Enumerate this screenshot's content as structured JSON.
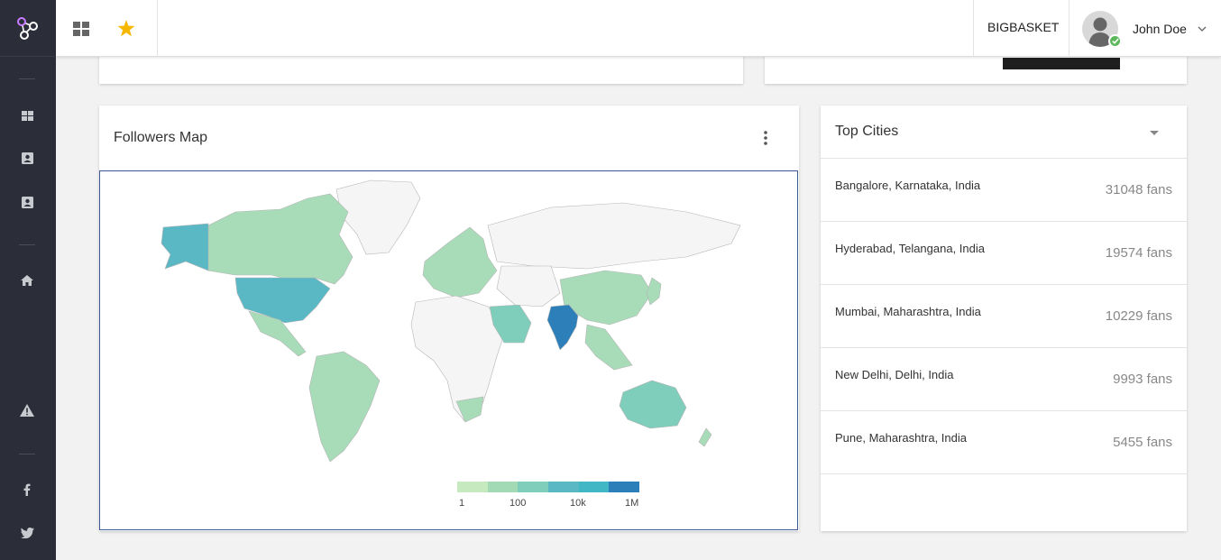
{
  "topbar": {
    "company": "BIGBASKET",
    "user_name": "John Doe"
  },
  "followers_map": {
    "title": "Followers Map",
    "legend_labels": [
      "1",
      "100",
      "10k",
      "1M"
    ],
    "legend_colors": [
      "#c7e9c0",
      "#a1dab4",
      "#7fcdbb",
      "#5ab8c5",
      "#41b6c4",
      "#2c7fb8"
    ]
  },
  "top_cities": {
    "title": "Top Cities",
    "cities": [
      {
        "name": "Bangalore, Karnataka, India",
        "fans": "31048 fans"
      },
      {
        "name": "Hyderabad, Telangana, India",
        "fans": "19574 fans"
      },
      {
        "name": "Mumbai, Maharashtra, India",
        "fans": "10229 fans"
      },
      {
        "name": "New Delhi, Delhi, India",
        "fans": "9993 fans"
      },
      {
        "name": "Pune, Maharashtra, India",
        "fans": "5455 fans"
      }
    ]
  },
  "colors": {
    "sidebar": "#2b2e38",
    "star": "#f5b700",
    "online": "#5cb85c",
    "map_high": "#2c7fb8",
    "map_mid": "#7fcdbb",
    "map_low": "#a8dcb8",
    "map_none": "#f5f5f5"
  }
}
